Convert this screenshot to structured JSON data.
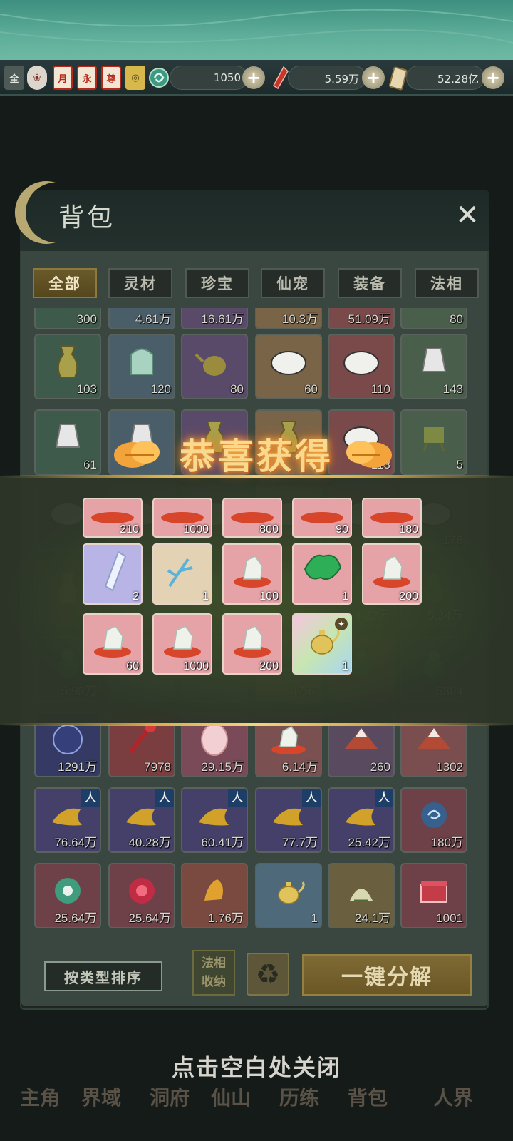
{
  "header": {
    "badges": [
      "全",
      "",
      "月",
      "永",
      "尊",
      ""
    ],
    "resources": [
      {
        "value": "1050",
        "icon": "jade-swirl-icon"
      },
      {
        "value": "5.59万",
        "icon": "red-crystal-icon"
      },
      {
        "value": "52.28亿",
        "icon": "talisman-icon"
      }
    ],
    "plus": "+"
  },
  "bag": {
    "title": "背包",
    "close": "✕",
    "tabs": [
      "全部",
      "灵材",
      "珍宝",
      "仙宠",
      "装备",
      "法相"
    ],
    "active_tab": 0,
    "row0_counts": [
      "300",
      "4.61万",
      "16.61万",
      "10.3万",
      "51.09万",
      "80"
    ],
    "rows": [
      {
        "counts": [
          "103",
          "120",
          "80",
          "60",
          "110",
          "143"
        ]
      },
      {
        "counts": [
          "61",
          "",
          "",
          "",
          "113",
          "5"
        ]
      },
      {
        "counts": [
          "",
          "",
          "",
          "",
          "",
          "176"
        ]
      },
      {
        "counts": [
          "7",
          "",
          "",
          "",
          "4.27万",
          "5.34万"
        ]
      },
      {
        "counts": [
          "5.93万",
          "",
          "",
          "4737",
          "",
          "5304"
        ]
      },
      {
        "counts": [
          "1291万",
          "7978",
          "29.15万",
          "6.14万",
          "260",
          "1302"
        ]
      },
      {
        "counts": [
          "76.64万",
          "40.28万",
          "60.41万",
          "77.7万",
          "25.42万",
          "180万"
        ],
        "ren": "人"
      },
      {
        "counts": [
          "25.64万",
          "25.64万",
          "1.76万",
          "1",
          "24.1万",
          "1001"
        ]
      }
    ],
    "sort_label": "按类型排序",
    "faxiang_label_1": "法相",
    "faxiang_label_2": "收纳",
    "recycle_icon": "♻",
    "decompose_label": "一键分解"
  },
  "reward": {
    "title": "恭喜获得",
    "row1": [
      "210",
      "1000",
      "800",
      "90",
      "180"
    ],
    "row2": [
      {
        "count": "2",
        "icon": "crystal-shard-icon"
      },
      {
        "count": "1",
        "icon": "ice-branch-icon"
      },
      {
        "count": "100",
        "icon": "spirit-stone-icon"
      },
      {
        "count": "1",
        "icon": "green-leaf-icon"
      },
      {
        "count": "200",
        "icon": "spirit-stone-icon"
      }
    ],
    "row3": [
      {
        "count": "60",
        "icon": "spirit-stone-icon"
      },
      {
        "count": "1000",
        "icon": "spirit-stone-icon"
      },
      {
        "count": "200",
        "icon": "spirit-stone-icon"
      },
      {
        "count": "1",
        "icon": "golden-teapot-icon"
      }
    ]
  },
  "close_hint": "点击空白处关闭",
  "bottom_nav": [
    "主角",
    "界域",
    "洞府",
    "仙山",
    "历练",
    "背包",
    "人界"
  ],
  "colors": {
    "gold": "#f9d98e",
    "panel": "#1f2622",
    "teal": "#5eae9a"
  }
}
